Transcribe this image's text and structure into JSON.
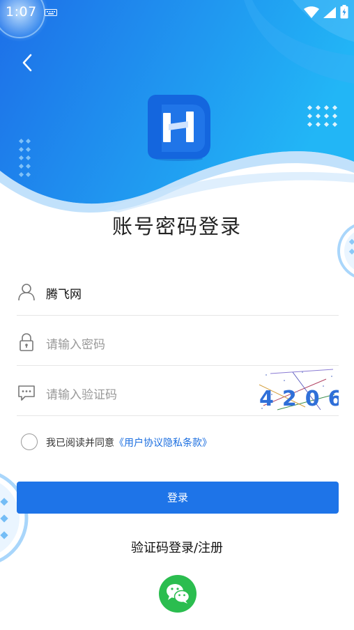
{
  "status_bar": {
    "time": "1:07"
  },
  "page": {
    "title": "账号密码登录"
  },
  "form": {
    "username_value": "腾飞网",
    "password_placeholder": "请输入密码",
    "captcha_placeholder": "请输入验证码",
    "captcha_code": "4206"
  },
  "agreement": {
    "prefix": "我已阅读并同意",
    "link": "《用户协议隐私条款》",
    "checked": false
  },
  "actions": {
    "login_label": "登录",
    "sms_login_label": "验证码登录/注册"
  },
  "colors": {
    "primary": "#1e74e8",
    "header_gradient_start": "#1d6fe8",
    "header_gradient_end": "#22b4f5",
    "wechat": "#2bbd4f",
    "link": "#1c6fe0"
  },
  "icons": [
    "back-icon",
    "user-icon",
    "lock-icon",
    "chat-icon",
    "wechat-icon",
    "wifi-icon",
    "signal-icon",
    "battery-icon",
    "keyboard-icon"
  ]
}
